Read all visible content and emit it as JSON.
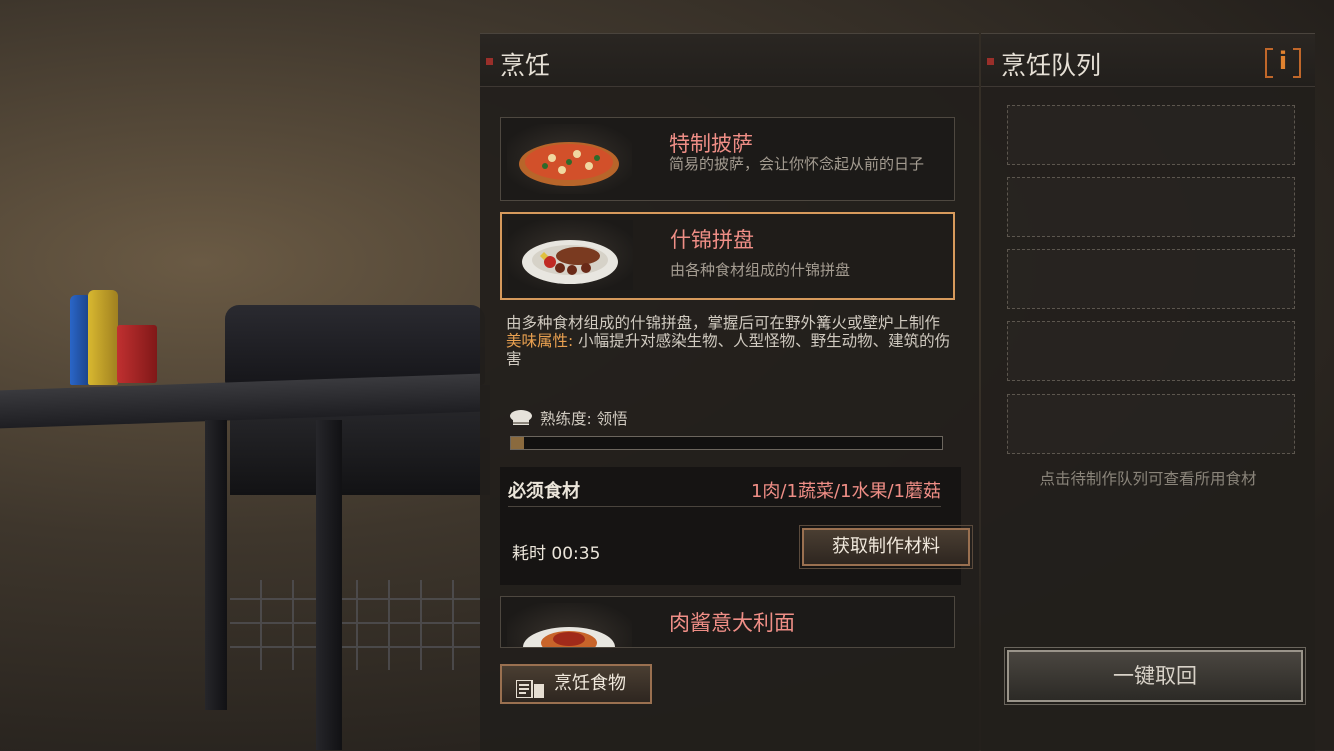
{
  "cooking_panel": {
    "title": "烹饪",
    "recipes": [
      {
        "title": "特制披萨",
        "desc": "简易的披萨，会让你怀念起从前的日子",
        "icon": "pizza-icon"
      },
      {
        "title": "什锦拼盘",
        "desc": "由各种食材组成的什锦拼盘",
        "icon": "platter-icon"
      },
      {
        "title": "肉酱意大利面",
        "icon": "spaghetti-icon"
      }
    ],
    "detail": {
      "description": "由多种食材组成的什锦拼盘，掌握后可在野外篝火或壁炉上制作",
      "attr_label": "美味属性:",
      "attr_value": "小幅提升对感染生物、人型怪物、野生动物、建筑的伤害",
      "mastery_label": "熟练度: 领悟",
      "mastery_progress": 0.03,
      "required_label": "必须食材",
      "required_value": "1肉/1蔬菜/1水果/1蘑菇",
      "time_label": "耗时 00:35",
      "get_materials_button": "获取制作材料"
    },
    "cook_button": "烹饪食物"
  },
  "queue_panel": {
    "title": "烹饪队列",
    "info_button": "i",
    "slots": 5,
    "hint": "点击待制作队列可查看所用食材",
    "recall_button": "一键取回"
  },
  "colors": {
    "accent_orange": "#d79a5c",
    "title_pink": "#ef8e86",
    "attribute_orange": "#e8a050",
    "marker_red": "#9a2f2a"
  }
}
